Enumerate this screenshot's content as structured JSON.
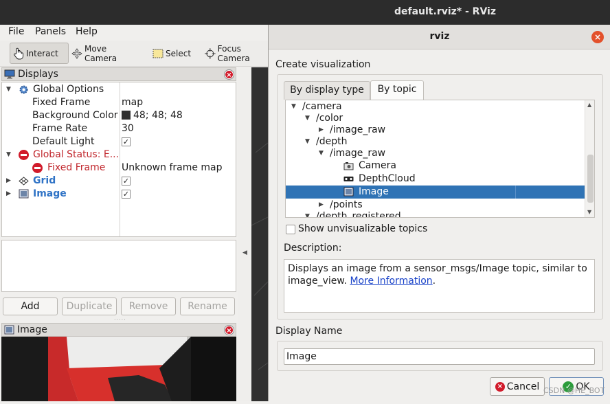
{
  "window": {
    "title": "default.rviz* - RViz"
  },
  "menu": [
    "File",
    "Panels",
    "Help"
  ],
  "toolbar": {
    "interact": "Interact",
    "move_camera": "Move Camera",
    "select": "Select",
    "focus_camera": "Focus Camera"
  },
  "displays": {
    "title": "Displays",
    "global_options": "Global Options",
    "fixed_frame_label": "Fixed Frame",
    "fixed_frame_value": "map",
    "bg_color_label": "Background Color",
    "bg_color_value": "48; 48; 48",
    "bg_color_hex": "#303030",
    "frame_rate_label": "Frame Rate",
    "frame_rate_value": "30",
    "default_light_label": "Default Light",
    "default_light_checked": true,
    "global_status": "Global Status: E...",
    "status_fixed_frame": "Fixed Frame",
    "status_fixed_frame_value": "Unknown frame map",
    "grid": "Grid",
    "grid_checked": true,
    "image": "Image",
    "image_checked": true
  },
  "buttons": {
    "add": "Add",
    "duplicate": "Duplicate",
    "remove": "Remove",
    "rename": "Rename"
  },
  "image_panel": {
    "title": "Image"
  },
  "dialog": {
    "title": "rviz",
    "create_visualization": "Create visualization",
    "tabs": [
      "By display type",
      "By topic"
    ],
    "selected_tab": "By topic",
    "topics": [
      {
        "label": "/camera",
        "depth": 0,
        "expander": "open"
      },
      {
        "label": "/color",
        "depth": 1,
        "expander": "open"
      },
      {
        "label": "/image_raw",
        "depth": 2,
        "expander": "closed"
      },
      {
        "label": "/depth",
        "depth": 1,
        "expander": "open"
      },
      {
        "label": "/image_raw",
        "depth": 2,
        "expander": "open"
      },
      {
        "label": "Camera",
        "depth": 3,
        "icon": "camera-icon"
      },
      {
        "label": "DepthCloud",
        "depth": 3,
        "icon": "depthcloud-icon"
      },
      {
        "label": "Image",
        "depth": 3,
        "icon": "image-icon",
        "selected": true
      },
      {
        "label": "/points",
        "depth": 2,
        "expander": "closed"
      },
      {
        "label": "/depth_registered",
        "depth": 1,
        "expander": "open"
      }
    ],
    "show_unvisualizable": "Show unvisualizable topics",
    "show_unvisualizable_checked": false,
    "description_label": "Description:",
    "description_text": "Displays an image from a sensor_msgs/Image topic, similar to image_view.",
    "description_link": "More Information",
    "description_end": ".",
    "display_name_label": "Display Name",
    "display_name_value": "Image",
    "cancel": "Cancel",
    "ok": "OK"
  },
  "watermark": "CSDN @HE_BOT",
  "colors": {
    "selection": "#2f73b5",
    "error": "#c1272d",
    "link": "#1a43c9",
    "blue_label": "#2f73c6"
  }
}
